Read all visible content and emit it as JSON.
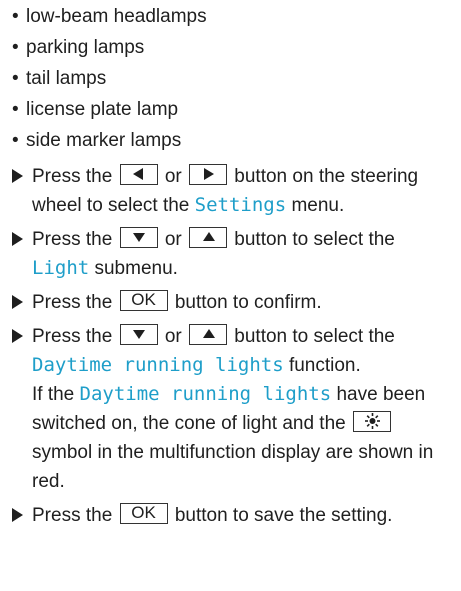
{
  "bullets": [
    "low-beam headlamps",
    "parking lamps",
    "tail lamps",
    "license plate lamp",
    "side marker lamps"
  ],
  "steps": {
    "s1": {
      "a": "Press the",
      "or": "or",
      "b": "button on the steering wheel to select the",
      "menu": "Settings",
      "c": "menu."
    },
    "s2": {
      "a": "Press the",
      "or": "or",
      "b": "button to select the",
      "menu": "Light",
      "c": "submenu."
    },
    "s3": {
      "a": "Press the",
      "key": "OK",
      "b": "button to confirm."
    },
    "s4": {
      "a": "Press the",
      "or": "or",
      "b": "button to select the",
      "func": "Daytime running lights",
      "c": "function.",
      "d": "If the",
      "func2": "Daytime running lights",
      "e": "have been switched on, the cone of light and the",
      "f": "symbol in the multifunction display are shown in red."
    },
    "s5": {
      "a": "Press the",
      "key": "OK",
      "b": "button to save the setting."
    }
  },
  "icons": {
    "left": "left-arrow-key",
    "right": "right-arrow-key",
    "down": "down-arrow-key",
    "up": "up-arrow-key",
    "sun": "daytime-lights-symbol"
  },
  "colors": {
    "menu_text": "#1e9ec9",
    "text": "#1f1f1f"
  }
}
